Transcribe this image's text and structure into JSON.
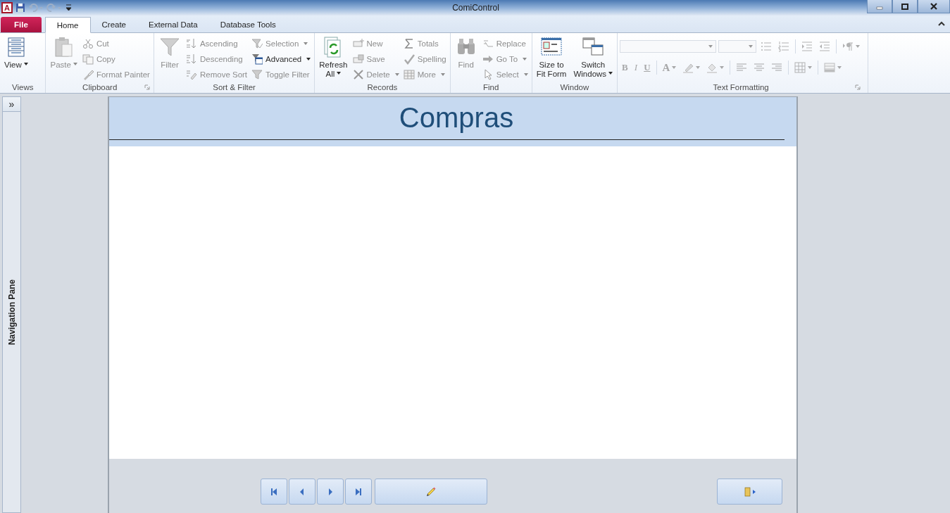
{
  "window": {
    "logo": "A",
    "title": "ComiControl"
  },
  "tabs": [
    {
      "label": "File",
      "kind": "file",
      "selected": false
    },
    {
      "label": "Home",
      "kind": "tab",
      "selected": true
    },
    {
      "label": "Create",
      "kind": "tab",
      "selected": false
    },
    {
      "label": "External Data",
      "kind": "tab",
      "selected": false
    },
    {
      "label": "Database Tools",
      "kind": "tab",
      "selected": false
    }
  ],
  "ribbon": {
    "groups": [
      {
        "label": "Views",
        "launcher": false,
        "columns": [
          {
            "kind": "large",
            "items": [
              {
                "label": "View",
                "disabled": false,
                "dropdown": true
              }
            ]
          }
        ]
      },
      {
        "label": "Clipboard",
        "launcher": true,
        "columns": [
          {
            "kind": "large",
            "items": [
              {
                "label": "Paste",
                "disabled": true,
                "dropdown": true
              }
            ]
          },
          {
            "kind": "small",
            "items": [
              {
                "label": "Cut",
                "disabled": true,
                "dropdown": false
              },
              {
                "label": "Copy",
                "disabled": true,
                "dropdown": false
              },
              {
                "label": "Format Painter",
                "disabled": true,
                "dropdown": false
              }
            ]
          }
        ]
      },
      {
        "label": "Sort & Filter",
        "launcher": false,
        "columns": [
          {
            "kind": "large",
            "items": [
              {
                "label": "Filter",
                "disabled": true,
                "dropdown": false
              }
            ]
          },
          {
            "kind": "small",
            "items": [
              {
                "label": "Ascending",
                "disabled": true,
                "dropdown": false
              },
              {
                "label": "Descending",
                "disabled": true,
                "dropdown": false
              },
              {
                "label": "Remove Sort",
                "disabled": true,
                "dropdown": false
              }
            ]
          },
          {
            "kind": "small",
            "items": [
              {
                "label": "Selection",
                "disabled": true,
                "dropdown": true
              },
              {
                "label": "Advanced",
                "disabled": false,
                "dropdown": true
              },
              {
                "label": "Toggle Filter",
                "disabled": true,
                "dropdown": false
              }
            ]
          }
        ]
      },
      {
        "label": "Records",
        "launcher": false,
        "columns": [
          {
            "kind": "large",
            "items": [
              {
                "label": "Refresh\nAll",
                "disabled": false,
                "dropdown": true
              }
            ]
          },
          {
            "kind": "small",
            "items": [
              {
                "label": "New",
                "disabled": true,
                "dropdown": false
              },
              {
                "label": "Save",
                "disabled": true,
                "dropdown": false
              },
              {
                "label": "Delete",
                "disabled": true,
                "dropdown": true
              }
            ]
          },
          {
            "kind": "small",
            "items": [
              {
                "label": "Totals",
                "disabled": true,
                "dropdown": false
              },
              {
                "label": "Spelling",
                "disabled": true,
                "dropdown": false
              },
              {
                "label": "More",
                "disabled": true,
                "dropdown": true
              }
            ]
          }
        ]
      },
      {
        "label": "Find",
        "launcher": false,
        "columns": [
          {
            "kind": "large",
            "items": [
              {
                "label": "Find",
                "disabled": true,
                "dropdown": false
              }
            ]
          },
          {
            "kind": "small",
            "items": [
              {
                "label": "Replace",
                "disabled": true,
                "dropdown": false
              },
              {
                "label": "Go To",
                "disabled": true,
                "dropdown": true
              },
              {
                "label": "Select",
                "disabled": true,
                "dropdown": true
              }
            ]
          }
        ]
      },
      {
        "label": "Window",
        "launcher": false,
        "columns": [
          {
            "kind": "large",
            "items": [
              {
                "label": "Size to\nFit Form",
                "disabled": false,
                "dropdown": false
              }
            ]
          },
          {
            "kind": "large",
            "items": [
              {
                "label": "Switch\nWindows",
                "disabled": false,
                "dropdown": true
              }
            ]
          }
        ]
      },
      {
        "label": "Text Formatting",
        "launcher": true,
        "columns": [
          {
            "kind": "format",
            "rows": [
              [
                {
                  "kind": "font-name",
                  "disabled": true
                },
                {
                  "kind": "font-size",
                  "disabled": true
                },
                {
                  "kind": "icon",
                  "disabled": true,
                  "dropdown": false
                },
                {
                  "kind": "icon",
                  "disabled": true,
                  "dropdown": false
                },
                {
                  "kind": "sep"
                },
                {
                  "kind": "icon",
                  "disabled": true,
                  "dropdown": false
                },
                {
                  "kind": "icon",
                  "disabled": true,
                  "dropdown": false
                },
                {
                  "kind": "sep"
                },
                {
                  "kind": "icon",
                  "disabled": true,
                  "dropdown": true
                }
              ],
              [
                {
                  "kind": "glyph",
                  "text": "B",
                  "disabled": true,
                  "dropdown": false
                },
                {
                  "kind": "glyph",
                  "text": "I",
                  "disabled": true,
                  "dropdown": false
                },
                {
                  "kind": "glyph",
                  "text": "U",
                  "disabled": true,
                  "dropdown": false
                },
                {
                  "kind": "sep"
                },
                {
                  "kind": "glyph",
                  "text": "A",
                  "disabled": true,
                  "dropdown": true
                },
                {
                  "kind": "icon",
                  "disabled": true,
                  "dropdown": true
                },
                {
                  "kind": "icon",
                  "disabled": true,
                  "dropdown": true
                },
                {
                  "kind": "sep"
                },
                {
                  "kind": "icon",
                  "disabled": true,
                  "dropdown": false
                },
                {
                  "kind": "icon",
                  "disabled": true,
                  "dropdown": false
                },
                {
                  "kind": "icon",
                  "disabled": true,
                  "dropdown": false
                },
                {
                  "kind": "sep"
                },
                {
                  "kind": "icon",
                  "disabled": true,
                  "dropdown": true
                },
                {
                  "kind": "sep"
                },
                {
                  "kind": "icon",
                  "disabled": true,
                  "dropdown": true
                }
              ]
            ]
          }
        ]
      }
    ]
  },
  "navigation_pane": {
    "toggle": "»",
    "label": "Navigation Pane"
  },
  "form": {
    "title": "Compras"
  }
}
